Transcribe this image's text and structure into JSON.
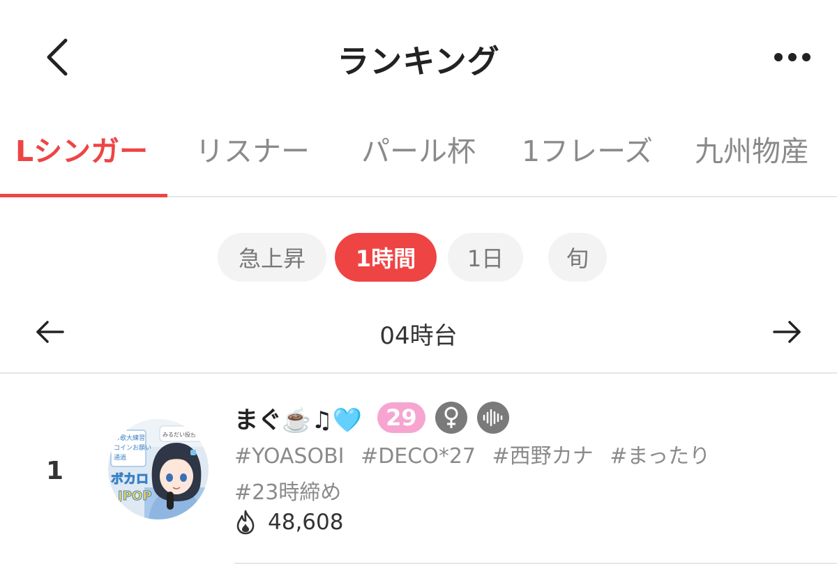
{
  "header": {
    "title": "ランキング",
    "back_icon": "chevron-left-icon",
    "more_icon": "more-horizontal-icon"
  },
  "tabs": [
    {
      "label": "Lシンガー",
      "active": true
    },
    {
      "label": "リスナー",
      "active": false
    },
    {
      "label": "パール杯",
      "active": false
    },
    {
      "label": "1フレーズ",
      "active": false
    },
    {
      "label": "九州物産",
      "active": false
    }
  ],
  "periods": [
    {
      "label": "急上昇",
      "active": false
    },
    {
      "label": "1時間",
      "active": true
    },
    {
      "label": "1日",
      "active": false
    },
    {
      "label": "旬",
      "active": false
    }
  ],
  "hour_nav": {
    "label": "04時台",
    "prev_icon": "arrow-left-icon",
    "next_icon": "arrow-right-icon"
  },
  "ranking": [
    {
      "rank": "1",
      "name": "まぐ☕️♫🩵",
      "age": "29",
      "gender_icon": "female-icon",
      "voice_icon": "audio-wave-icon",
      "tags": [
        "#YOASOBI",
        "#DECO*27",
        "#西野カナ",
        "#まったり",
        "#23時締め"
      ],
      "score_icon": "flame-icon",
      "score": "48,608",
      "avatar_text": {
        "line1": "ボカロ",
        "line2": "JPOP",
        "board1": "お歌大練習",
        "board2": "コインお願い",
        "board3": "通過",
        "sign": "みるだい投合歌ぞ"
      }
    }
  ],
  "colors": {
    "accent": "#ef4444",
    "age_badge": "#f6a5d0",
    "chip_bg": "#f3f3f3",
    "muted_text": "#8a8a8a"
  }
}
